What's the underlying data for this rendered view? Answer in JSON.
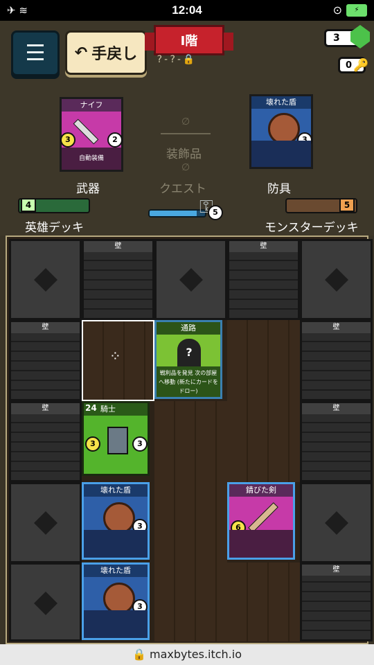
{
  "status": {
    "time": "12:04"
  },
  "header": {
    "undo_label": "手戻し",
    "floor_label": "I階",
    "map_path": "?-?-",
    "gems": "3",
    "keys": "0"
  },
  "equipment": {
    "weapon_name": "ナイフ",
    "weapon_attack": "3",
    "weapon_durability": "2",
    "weapon_note": "自動装備",
    "armor_name": "壊れた盾",
    "armor_value": "3",
    "accessory_label": "装飾品",
    "quest_label": "クエスト",
    "weapon_label": "武器",
    "armor_label": "防具",
    "hero_deck_label": "英雄デッキ",
    "hero_deck_count": "4",
    "monster_deck_label": "モンスターデッキ",
    "monster_deck_count": "5",
    "quest_count": "5",
    "quest_progress": 0.85
  },
  "board": {
    "wall_label": "壁",
    "knight": {
      "name": "騎士",
      "hp": "24",
      "attack": "3",
      "defense": "3"
    },
    "passage": {
      "name": "通路",
      "desc": "戦利品を発見 次の部屋へ移動 (新たにカードをドロー)"
    },
    "shield1": {
      "name": "壊れた盾",
      "value": "3"
    },
    "shield2": {
      "name": "壊れた盾",
      "value": "3"
    },
    "sword": {
      "name": "錆びた剣",
      "value": "6"
    }
  },
  "url": "maxbytes.itch.io"
}
